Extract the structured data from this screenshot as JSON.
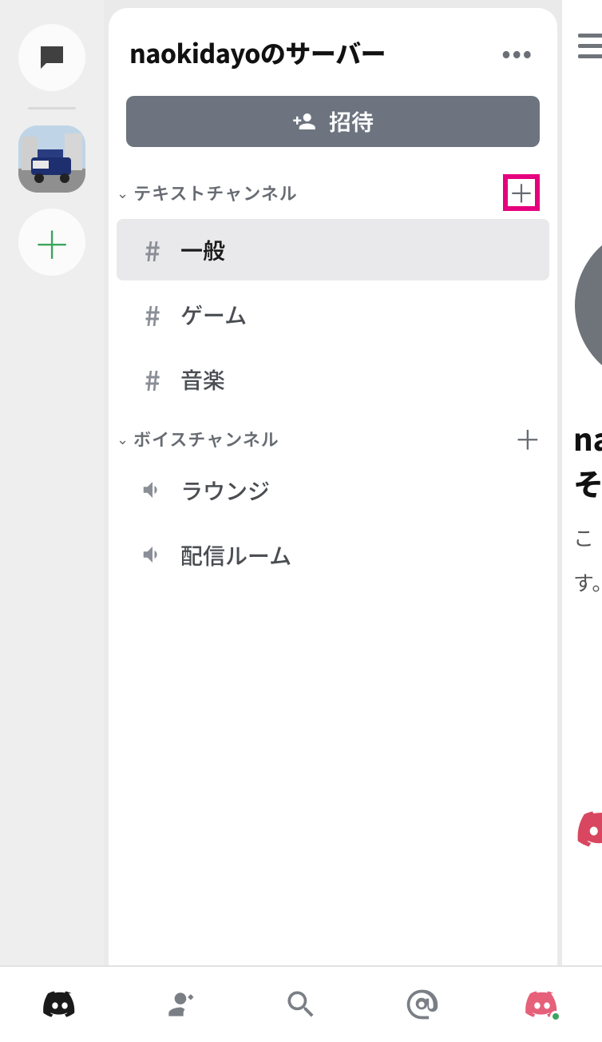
{
  "server": {
    "title": "naokidayoのサーバー",
    "invite_label": "招待"
  },
  "categories": [
    {
      "label": "テキストチャンネル",
      "add_highlighted": true,
      "channels": [
        {
          "icon": "hash",
          "label": "一般",
          "active": true
        },
        {
          "icon": "hash",
          "label": "ゲーム",
          "active": false
        },
        {
          "icon": "hash",
          "label": "音楽",
          "active": false
        }
      ]
    },
    {
      "label": "ボイスチャンネル",
      "add_highlighted": false,
      "channels": [
        {
          "icon": "speaker",
          "label": "ラウンジ",
          "active": false
        },
        {
          "icon": "speaker",
          "label": "配信ルーム",
          "active": false
        }
      ]
    }
  ],
  "right_peek": {
    "line1": "na",
    "line2": "そ",
    "line3": "こ",
    "line4": "す。"
  },
  "icons": {
    "dm": "speech-bubble",
    "add_server": "plus",
    "more": "ellipsis",
    "invite": "person-plus",
    "hash": "#",
    "speaker": "volume"
  },
  "colors": {
    "highlight": "#e6007e",
    "accent_green": "#3ba55d",
    "invite_bg": "#6d7480"
  }
}
